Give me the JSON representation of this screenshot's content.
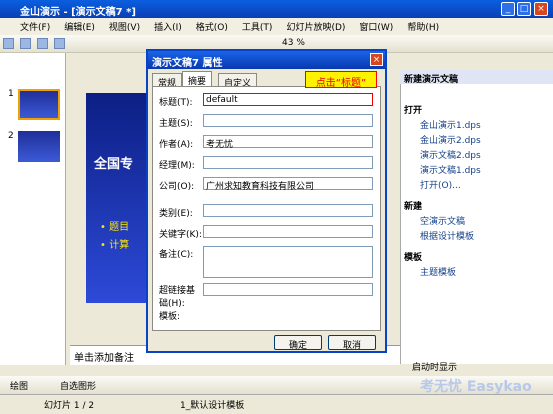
{
  "window": {
    "title": "金山演示 - [演示文稿7 *]"
  },
  "menu": [
    "文件(F)",
    "编辑(E)",
    "视图(V)",
    "插入(I)",
    "格式(O)",
    "工具(T)",
    "幻灯片放映(D)",
    "窗口(W)",
    "帮助(H)"
  ],
  "toolbar": {
    "zoom": "43 %"
  },
  "dialog": {
    "title": "演示文稿7 属性",
    "tabs": [
      "常规",
      "摘要",
      "自定义"
    ],
    "labels": [
      "标题(T):",
      "主题(S):",
      "作者(A):",
      "经理(M):",
      "公司(O):",
      "类别(E):",
      "关键字(K):",
      "备注(C):",
      "超链接基础(H):",
      "模板:"
    ],
    "values": {
      "title": "default",
      "author": "考无忧",
      "company": "广州求知教育科技有限公司"
    },
    "ok": "确定",
    "cancel": "取消"
  },
  "callout": "点击“标题”",
  "notes": "单击添加备注",
  "taskpane": {
    "title": "新建演示文稿",
    "open_label": "打开",
    "files": [
      "金山演示1.dps",
      "金山演示2.dps",
      "演示文稿2.dps",
      "演示文稿1.dps"
    ],
    "open_more": "打开(O)...",
    "new_label": "新建",
    "new_items": [
      "空演示文稿",
      "根据设计模板"
    ],
    "template_label": "模板",
    "template_items": [
      "主题模板"
    ],
    "startup": "启动时显示"
  },
  "slides": [
    "1",
    "2"
  ],
  "slide": {
    "title_partial": "全国专",
    "bullets": [
      "• 题目",
      "• 计算"
    ]
  },
  "draw": {
    "label": "绘图",
    "autoshape": "自选图形"
  },
  "status": {
    "slide": "幻灯片 1 / 2",
    "template": "1_默认设计模板"
  },
  "watermark": "考无忧 Easykao"
}
